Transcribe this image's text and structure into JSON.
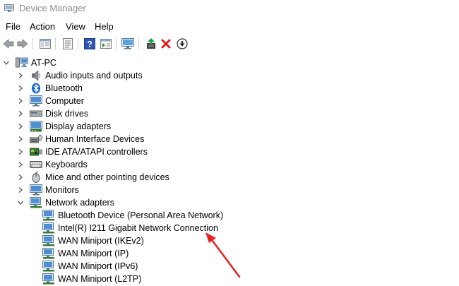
{
  "window": {
    "title": "Device Manager"
  },
  "menu": [
    {
      "label": "File"
    },
    {
      "label": "Action"
    },
    {
      "label": "View"
    },
    {
      "label": "Help"
    }
  ],
  "tree": {
    "root": "AT-PC",
    "categories": [
      {
        "label": "Audio inputs and outputs",
        "icon": "speaker-icon"
      },
      {
        "label": "Bluetooth",
        "icon": "bluetooth-icon"
      },
      {
        "label": "Computer",
        "icon": "computer-icon"
      },
      {
        "label": "Disk drives",
        "icon": "disk-drive-icon"
      },
      {
        "label": "Display adapters",
        "icon": "display-adapter-icon"
      },
      {
        "label": "Human Interface Devices",
        "icon": "hid-icon"
      },
      {
        "label": "IDE ATA/ATAPI controllers",
        "icon": "ide-controller-icon"
      },
      {
        "label": "Keyboards",
        "icon": "keyboard-icon"
      },
      {
        "label": "Mice and other pointing devices",
        "icon": "mouse-icon"
      },
      {
        "label": "Monitors",
        "icon": "monitor-icon"
      },
      {
        "label": "Network adapters",
        "icon": "network-adapter-icon",
        "expanded": true
      }
    ],
    "network_adapters": [
      {
        "label": "Bluetooth Device (Personal Area Network)"
      },
      {
        "label": "Intel(R) I211 Gigabit Network Connection"
      },
      {
        "label": "WAN Miniport (IKEv2)"
      },
      {
        "label": "WAN Miniport (IP)"
      },
      {
        "label": "WAN Miniport (IPv6)"
      },
      {
        "label": "WAN Miniport (L2TP)"
      }
    ]
  },
  "annotation": {
    "color": "#e8201f"
  }
}
